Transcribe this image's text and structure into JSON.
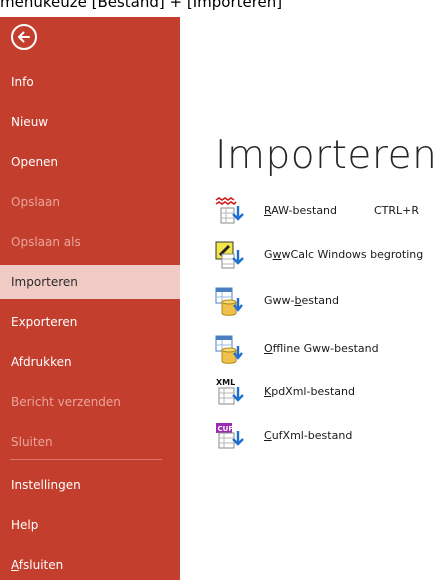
{
  "caption": "menukeuze [Bestand] + [Importeren]",
  "sidebar": {
    "items": [
      {
        "label": "Info",
        "state": "normal"
      },
      {
        "label": "Nieuw",
        "state": "normal"
      },
      {
        "label": "Openen",
        "state": "normal"
      },
      {
        "label": "Opslaan",
        "state": "disabled"
      },
      {
        "label": "Opslaan als",
        "state": "disabled"
      },
      {
        "label": "Importeren",
        "state": "selected"
      },
      {
        "label": "Exporteren",
        "state": "normal"
      },
      {
        "label": "Afdrukken",
        "state": "normal"
      },
      {
        "label": "Bericht verzenden",
        "state": "disabled"
      },
      {
        "label": "Sluiten",
        "state": "disabled"
      },
      {
        "label": "Instellingen",
        "state": "normal"
      },
      {
        "label": "Help",
        "state": "normal"
      },
      {
        "label_ul": "A",
        "label_rest": "fsluiten",
        "state": "normal"
      }
    ]
  },
  "main": {
    "title": "Importeren",
    "items": [
      {
        "icon": "raw-import-icon",
        "ul": "R",
        "rest": "AW-bestand",
        "shortcut": "CTRL+R"
      },
      {
        "icon": "gwwcalc-import-icon",
        "pre": "G",
        "ul": "w",
        "rest": "wCalc Windows begroting"
      },
      {
        "icon": "gww-import-icon",
        "pre": "Gww-",
        "ul": "b",
        "rest": "estand"
      },
      {
        "icon": "offline-gww-import-icon",
        "ul": "O",
        "rest": "ffline Gww-bestand"
      },
      {
        "icon": "kpdxml-import-icon",
        "ul": "K",
        "rest": "pdXml-bestand"
      },
      {
        "icon": "cufxml-import-icon",
        "ul": "C",
        "rest": "ufXml-bestand"
      }
    ]
  },
  "colors": {
    "sidebar_bg": "#c43e2e",
    "selected_bg": "#f0cbc5",
    "disabled_text": "#e9a59b",
    "arrow_blue": "#1f6fd1"
  }
}
